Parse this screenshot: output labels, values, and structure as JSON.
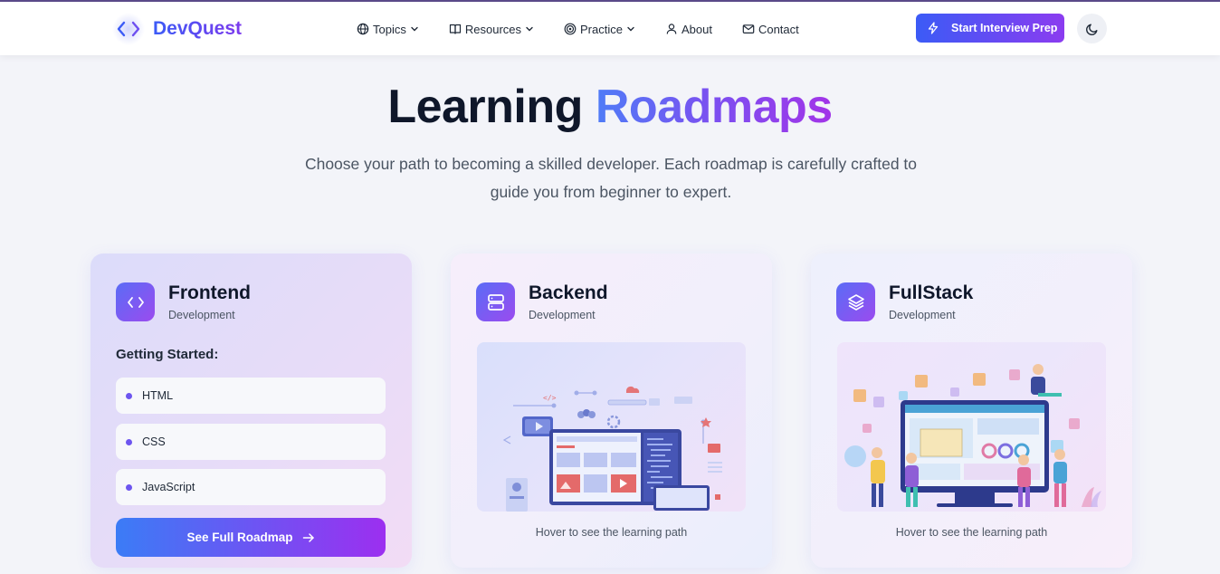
{
  "brand": {
    "name": "DevQuest",
    "icon": "code-icon"
  },
  "nav": {
    "items": [
      {
        "label": "Topics",
        "icon": "globe-icon",
        "dropdown": true
      },
      {
        "label": "Resources",
        "icon": "book-icon",
        "dropdown": true
      },
      {
        "label": "Practice",
        "icon": "target-icon",
        "dropdown": true
      },
      {
        "label": "About",
        "icon": "user-icon",
        "dropdown": false
      },
      {
        "label": "Contact",
        "icon": "mail-icon",
        "dropdown": false
      }
    ],
    "cta_label": "Start Interview Prep",
    "cta_icon": "lightning-icon",
    "theme_icon": "moon-icon"
  },
  "hero": {
    "title_plain": "Learning",
    "title_accent": "Roadmaps",
    "subtitle": "Choose your path to becoming a skilled developer. Each roadmap is carefully crafted to guide you from beginner to expert."
  },
  "cards": [
    {
      "title": "Frontend",
      "subtitle": "Development",
      "icon": "code-icon",
      "section_title": "Getting Started:",
      "items": [
        "HTML",
        "CSS",
        "JavaScript"
      ],
      "button_label": "See Full Roadmap",
      "button_icon": "arrow-right-icon"
    },
    {
      "title": "Backend",
      "subtitle": "Development",
      "icon": "server-icon",
      "hint": "Hover to see the learning path"
    },
    {
      "title": "FullStack",
      "subtitle": "Development",
      "icon": "layers-icon",
      "hint": "Hover to see the learning path"
    }
  ],
  "colors": {
    "accent_blue": "#3b5bf6",
    "accent_purple": "#8b3cf0",
    "background": "#f3f4f9",
    "heading": "#0f172a"
  }
}
